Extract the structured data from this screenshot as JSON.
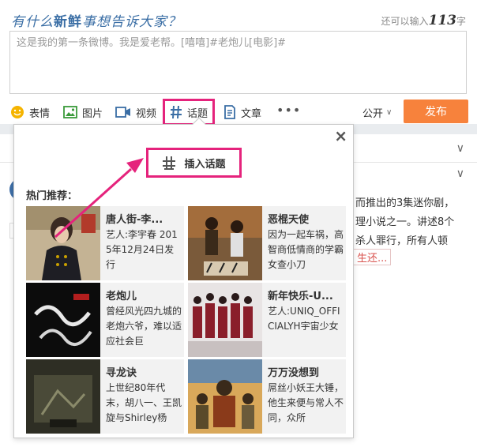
{
  "composer": {
    "prompt_pre": "有什么",
    "prompt_bold": "新鲜",
    "prompt_post": "事想告诉大家？",
    "counter_pre": "还可以输入",
    "counter_num": "113",
    "counter_post": "字",
    "textarea_value": "这是我的第一条微博。我是爱老帮。[嘻嘻]#老炮儿[电影]#"
  },
  "toolbar": {
    "emoji": "表情",
    "image": "图片",
    "video": "视频",
    "topic": "话题",
    "article": "文章",
    "more": "•••",
    "visibility": "公开",
    "publish": "发布"
  },
  "feed": {
    "line1": "而推出的3集迷你剧，",
    "line2": "理小说之一。讲述8个",
    "line3": "杀人罪行，所有人顿",
    "tag": "生还..."
  },
  "popup": {
    "close": "×",
    "insert": "插入话题",
    "hot_title": "热门推荐：",
    "cards": [
      {
        "title": "唐人街-李...",
        "desc": "艺人:李宇春 2015年12月24日发行"
      },
      {
        "title": "恶棍天使",
        "desc": "因为一起车祸，高智商低情商的学霸女查小刀"
      },
      {
        "title": "老炮儿",
        "desc": "曾经风光四九城的老炮六爷，难以适应社会巨"
      },
      {
        "title": "新年快乐-U...",
        "desc": "艺人:UNIQ_OFFICIALYH宇宙少女"
      },
      {
        "title": "寻龙诀",
        "desc": "上世纪80年代末，胡八一、王凯旋与Shirley杨"
      },
      {
        "title": "万万没想到",
        "desc": "屌丝小妖王大锤，他生来便与常人不同，众所"
      }
    ]
  },
  "colors": {
    "publish": "#f7823c",
    "highlight": "#e5237c",
    "title_blue": "#3a6ea5"
  }
}
